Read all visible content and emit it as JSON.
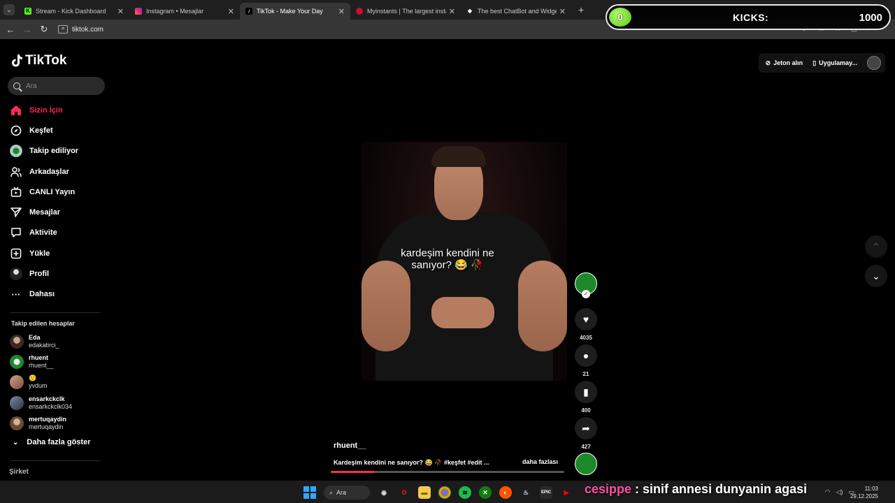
{
  "browser": {
    "tabs": [
      {
        "title": "Stream - Kick Dashboard",
        "icon": "kick-icon",
        "active": false
      },
      {
        "title": "Instagram • Mesajlar",
        "icon": "instagram-icon",
        "active": false
      },
      {
        "title": "TikTok - Make Your Day",
        "icon": "tiktok-icon",
        "active": true
      },
      {
        "title": "Myinstants | The largest instant",
        "icon": "myinstants-icon",
        "active": false
      },
      {
        "title": "The best ChatBot and Widgets",
        "icon": "chatbot-icon",
        "active": false
      }
    ],
    "url": "tiktok.com"
  },
  "kicks_overlay": {
    "counter": "0",
    "label": "KICKS:",
    "value": "1000"
  },
  "tiktok": {
    "logo_text": "TikTok",
    "search_placeholder": "Ara",
    "nav": [
      {
        "label": "Sizin İçin",
        "icon": "home-icon",
        "active": true
      },
      {
        "label": "Keşfet",
        "icon": "compass-icon"
      },
      {
        "label": "Takip ediliyor",
        "icon": "following-avatar-icon"
      },
      {
        "label": "Arkadaşlar",
        "icon": "friends-icon"
      },
      {
        "label": "CANLI Yayın",
        "icon": "live-icon"
      },
      {
        "label": "Mesajlar",
        "icon": "messages-icon"
      },
      {
        "label": "Aktivite",
        "icon": "activity-icon"
      },
      {
        "label": "Yükle",
        "icon": "upload-icon"
      },
      {
        "label": "Profil",
        "icon": "profile-icon"
      },
      {
        "label": "Dahası",
        "icon": "more-icon"
      }
    ],
    "following_title": "Takip edilen hesaplar",
    "following": [
      {
        "name": "Eda",
        "handle": "edakatirci_"
      },
      {
        "name": "rhuent",
        "handle": "rhuent__"
      },
      {
        "name": "🙂",
        "handle": "yvdum"
      },
      {
        "name": "ensarkckclk",
        "handle": "ensarkckclk034"
      },
      {
        "name": "mertuqaydin",
        "handle": "mertuqaydin"
      }
    ],
    "show_more": "Daha fazla göster",
    "company": "Şirket",
    "top_right": {
      "coins": "Jeton alın",
      "app": "Uygulamay..."
    },
    "video": {
      "caption_line1": "kardeşim kendini ne",
      "caption_line2": "sanıyor? 😂 🥀",
      "username": "rhuent__",
      "description": "Kardeşim kendini ne sanıyor? 😂 🥀 #keşfet #edit ...",
      "more": "daha fazlası",
      "progress": 0.19
    },
    "actions": {
      "likes": "4035",
      "comments": "21",
      "saves": "400",
      "shares": "427"
    }
  },
  "taskbar": {
    "search": "Ara",
    "ticker_user": "cesippe",
    "ticker_text": " : sinif annesi dunyanin agasi",
    "time": "11:03",
    "date": "29.12.2025"
  }
}
